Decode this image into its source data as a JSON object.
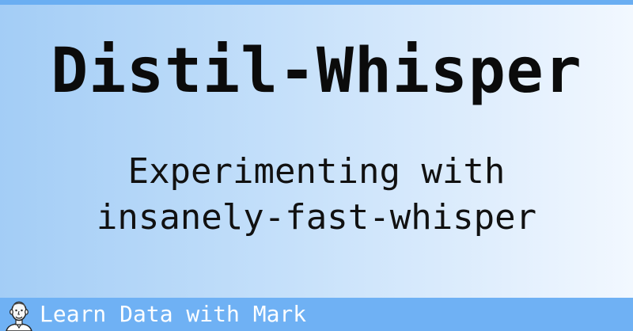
{
  "title": "Distil-Whisper",
  "subtitle": {
    "line1": "Experimenting with",
    "line2": "insanely-fast-whisper"
  },
  "footer": {
    "text": "Learn Data with Mark",
    "avatar_icon": "person-caricature-icon"
  },
  "colors": {
    "top_bar": "#6aaef2",
    "footer_bg": "#6fb1f4",
    "gradient_start": "#a3cdf6",
    "gradient_end": "#f2f8ff",
    "text": "#0b0b0b",
    "footer_text": "#ffffff"
  }
}
